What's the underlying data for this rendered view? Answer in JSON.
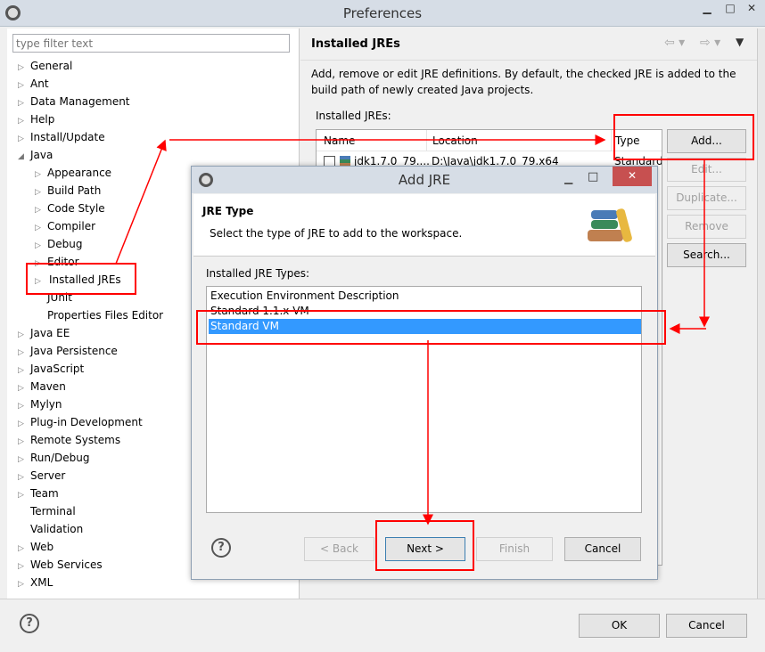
{
  "window": {
    "title": "Preferences"
  },
  "filter": {
    "placeholder": "type filter text"
  },
  "tree": [
    {
      "label": "General",
      "level": 0,
      "arrow": "▷"
    },
    {
      "label": "Ant",
      "level": 0,
      "arrow": "▷"
    },
    {
      "label": "Data Management",
      "level": 0,
      "arrow": "▷"
    },
    {
      "label": "Help",
      "level": 0,
      "arrow": "▷"
    },
    {
      "label": "Install/Update",
      "level": 0,
      "arrow": "▷"
    },
    {
      "label": "Java",
      "level": 0,
      "arrow": "◢"
    },
    {
      "label": "Appearance",
      "level": 1,
      "arrow": "▷"
    },
    {
      "label": "Build Path",
      "level": 1,
      "arrow": "▷"
    },
    {
      "label": "Code Style",
      "level": 1,
      "arrow": "▷"
    },
    {
      "label": "Compiler",
      "level": 1,
      "arrow": "▷"
    },
    {
      "label": "Debug",
      "level": 1,
      "arrow": "▷"
    },
    {
      "label": "Editor",
      "level": 1,
      "arrow": "▷"
    },
    {
      "label": "Installed JREs",
      "level": 1,
      "arrow": "▷",
      "selected": true
    },
    {
      "label": "JUnit",
      "level": 1,
      "arrow": ""
    },
    {
      "label": "Properties Files Editor",
      "level": 1,
      "arrow": ""
    },
    {
      "label": "Java EE",
      "level": 0,
      "arrow": "▷"
    },
    {
      "label": "Java Persistence",
      "level": 0,
      "arrow": "▷"
    },
    {
      "label": "JavaScript",
      "level": 0,
      "arrow": "▷"
    },
    {
      "label": "Maven",
      "level": 0,
      "arrow": "▷"
    },
    {
      "label": "Mylyn",
      "level": 0,
      "arrow": "▷"
    },
    {
      "label": "Plug-in Development",
      "level": 0,
      "arrow": "▷"
    },
    {
      "label": "Remote Systems",
      "level": 0,
      "arrow": "▷"
    },
    {
      "label": "Run/Debug",
      "level": 0,
      "arrow": "▷"
    },
    {
      "label": "Server",
      "level": 0,
      "arrow": "▷"
    },
    {
      "label": "Team",
      "level": 0,
      "arrow": "▷"
    },
    {
      "label": "Terminal",
      "level": 0,
      "arrow": ""
    },
    {
      "label": "Validation",
      "level": 0,
      "arrow": ""
    },
    {
      "label": "Web",
      "level": 0,
      "arrow": "▷"
    },
    {
      "label": "Web Services",
      "level": 0,
      "arrow": "▷"
    },
    {
      "label": "XML",
      "level": 0,
      "arrow": "▷"
    }
  ],
  "page": {
    "title": "Installed JREs",
    "description": "Add, remove or edit JRE definitions. By default, the checked JRE is added to the build path of newly created Java projects.",
    "list_label": "Installed JREs:",
    "columns": [
      "Name",
      "Location",
      "Type"
    ],
    "rows": [
      {
        "name": "jdk1.7.0_79....",
        "location": "D:\\Java\\jdk1.7.0_79.x64",
        "type": "Standard"
      }
    ],
    "buttons": {
      "add": "Add...",
      "edit": "Edit...",
      "duplicate": "Duplicate...",
      "remove": "Remove",
      "search": "Search..."
    }
  },
  "footer": {
    "ok": "OK",
    "cancel": "Cancel"
  },
  "dialog": {
    "title": "Add JRE",
    "header_title": "JRE Type",
    "header_desc": "Select the type of JRE to add to the workspace.",
    "list_label": "Installed JRE Types:",
    "types": [
      "Execution Environment Description",
      "Standard 1.1.x VM",
      "Standard VM"
    ],
    "selected": "Standard VM",
    "buttons": {
      "back": "< Back",
      "next": "Next >",
      "finish": "Finish",
      "cancel": "Cancel"
    }
  },
  "colors": {
    "annotation": "#ff0000",
    "selection": "#3399ff",
    "close": "#c75050"
  }
}
